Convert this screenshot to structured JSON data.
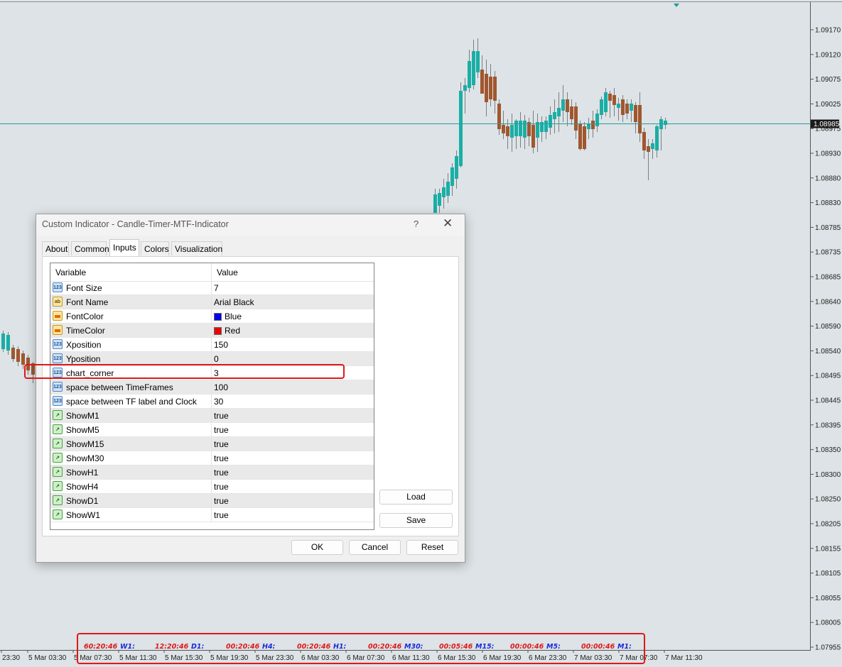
{
  "colors": {
    "background": "#dde3e6",
    "bull": "#1aaea6",
    "bear": "#a0572f",
    "price_line": "#2a9a9a",
    "timer_red": "#e01818",
    "timer_blue": "#1a2adc",
    "highlight": "#e01818"
  },
  "price_axis": {
    "labels": [
      "1.09170",
      "1.09120",
      "1.09075",
      "1.09025",
      "1.08975",
      "1.08930",
      "1.08880",
      "1.08830",
      "1.08785",
      "1.08735",
      "1.08685",
      "1.08640",
      "1.08590",
      "1.08540",
      "1.08495",
      "1.08445",
      "1.08395",
      "1.08350",
      "1.08300",
      "1.08250",
      "1.08205",
      "1.08155",
      "1.08105",
      "1.08055",
      "1.08005",
      "1.07955"
    ],
    "current_price": "1.08985"
  },
  "time_axis": {
    "labels": [
      "23:30",
      "5 Mar 03:30",
      "5 Mar 07:30",
      "5 Mar 11:30",
      "5 Mar 15:30",
      "5 Mar 19:30",
      "5 Mar 23:30",
      "6 Mar 03:30",
      "6 Mar 07:30",
      "6 Mar 11:30",
      "6 Mar 15:30",
      "6 Mar 19:30",
      "6 Mar 23:30",
      "7 Mar 03:30",
      "7 Mar 07:30",
      "7 Mar 11:30"
    ]
  },
  "candle_timer": {
    "items": [
      {
        "clock": "60:20:46",
        "tf": "W1:"
      },
      {
        "clock": "12:20:46",
        "tf": "D1:"
      },
      {
        "clock": "00:20:46",
        "tf": "H4:"
      },
      {
        "clock": "00:20:46",
        "tf": "H1:"
      },
      {
        "clock": "00:20:46",
        "tf": "M30:"
      },
      {
        "clock": "00:05:46",
        "tf": "M15:"
      },
      {
        "clock": "00:00:46",
        "tf": "M5:"
      },
      {
        "clock": "00:00:46",
        "tf": "M1:"
      }
    ]
  },
  "dialog": {
    "title": "Custom Indicator - Candle-Timer-MTF-Indicator",
    "help": "?",
    "close": "✕",
    "tabs": [
      {
        "label": "About",
        "active": false
      },
      {
        "label": "Common",
        "active": false
      },
      {
        "label": "Inputs",
        "active": true
      },
      {
        "label": "Colors",
        "active": false
      },
      {
        "label": "Visualization",
        "active": false
      }
    ],
    "grid": {
      "headers": {
        "variable": "Variable",
        "value": "Value"
      },
      "rows": [
        {
          "type": "num",
          "name": "Font Size",
          "value": "7"
        },
        {
          "type": "str",
          "name": "Font Name",
          "value": "Arial Black"
        },
        {
          "type": "color",
          "name": "FontColor",
          "value": "Blue",
          "swatch": "#0000ee"
        },
        {
          "type": "color",
          "name": "TimeColor",
          "value": "Red",
          "swatch": "#ee0000"
        },
        {
          "type": "num",
          "name": "Xposition",
          "value": "150"
        },
        {
          "type": "num",
          "name": "Yposition",
          "value": "0"
        },
        {
          "type": "num",
          "name": "chart_corner",
          "value": "3"
        },
        {
          "type": "num",
          "name": "space between TimeFrames",
          "value": "100"
        },
        {
          "type": "num",
          "name": "space between TF label and Clock",
          "value": "30"
        },
        {
          "type": "bool",
          "name": "ShowM1",
          "value": "true"
        },
        {
          "type": "bool",
          "name": "ShowM5",
          "value": "true"
        },
        {
          "type": "bool",
          "name": "ShowM15",
          "value": "true"
        },
        {
          "type": "bool",
          "name": "ShowM30",
          "value": "true"
        },
        {
          "type": "bool",
          "name": "ShowH1",
          "value": "true"
        },
        {
          "type": "bool",
          "name": "ShowH4",
          "value": "true"
        },
        {
          "type": "bool",
          "name": "ShowD1",
          "value": "true"
        },
        {
          "type": "bool",
          "name": "ShowW1",
          "value": "true"
        }
      ],
      "icon_labels": {
        "num": "123",
        "str": "ab"
      }
    },
    "buttons": {
      "load": "Load",
      "save": "Save",
      "ok": "OK",
      "cancel": "Cancel",
      "reset": "Reset"
    }
  }
}
